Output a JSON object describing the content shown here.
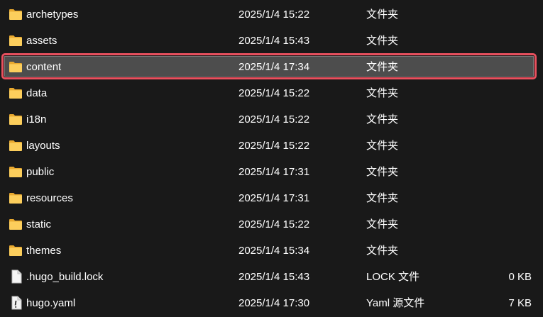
{
  "files": [
    {
      "name": "archetypes",
      "modified": "2025/1/4 15:22",
      "type": "文件夹",
      "size": "",
      "icon": "folder-icon",
      "selected": false
    },
    {
      "name": "assets",
      "modified": "2025/1/4 15:43",
      "type": "文件夹",
      "size": "",
      "icon": "folder-icon",
      "selected": false
    },
    {
      "name": "content",
      "modified": "2025/1/4 17:34",
      "type": "文件夹",
      "size": "",
      "icon": "folder-icon",
      "selected": true
    },
    {
      "name": "data",
      "modified": "2025/1/4 15:22",
      "type": "文件夹",
      "size": "",
      "icon": "folder-icon",
      "selected": false
    },
    {
      "name": "i18n",
      "modified": "2025/1/4 15:22",
      "type": "文件夹",
      "size": "",
      "icon": "folder-icon",
      "selected": false
    },
    {
      "name": "layouts",
      "modified": "2025/1/4 15:22",
      "type": "文件夹",
      "size": "",
      "icon": "folder-icon",
      "selected": false
    },
    {
      "name": "public",
      "modified": "2025/1/4 17:31",
      "type": "文件夹",
      "size": "",
      "icon": "folder-icon",
      "selected": false
    },
    {
      "name": "resources",
      "modified": "2025/1/4 17:31",
      "type": "文件夹",
      "size": "",
      "icon": "folder-icon",
      "selected": false
    },
    {
      "name": "static",
      "modified": "2025/1/4 15:22",
      "type": "文件夹",
      "size": "",
      "icon": "folder-icon",
      "selected": false
    },
    {
      "name": "themes",
      "modified": "2025/1/4 15:34",
      "type": "文件夹",
      "size": "",
      "icon": "folder-icon",
      "selected": false
    },
    {
      "name": ".hugo_build.lock",
      "modified": "2025/1/4 15:43",
      "type": "LOCK 文件",
      "size": "0 KB",
      "icon": "file-icon",
      "selected": false
    },
    {
      "name": "hugo.yaml",
      "modified": "2025/1/4 17:30",
      "type": "Yaml 源文件",
      "size": "7 KB",
      "icon": "yaml-file-icon",
      "selected": false
    }
  ],
  "colors": {
    "background": "#191919",
    "selection_fill": "#4d4d4d",
    "highlight_ring": "#e8505e",
    "folder_yellow": "#f8c44f"
  }
}
